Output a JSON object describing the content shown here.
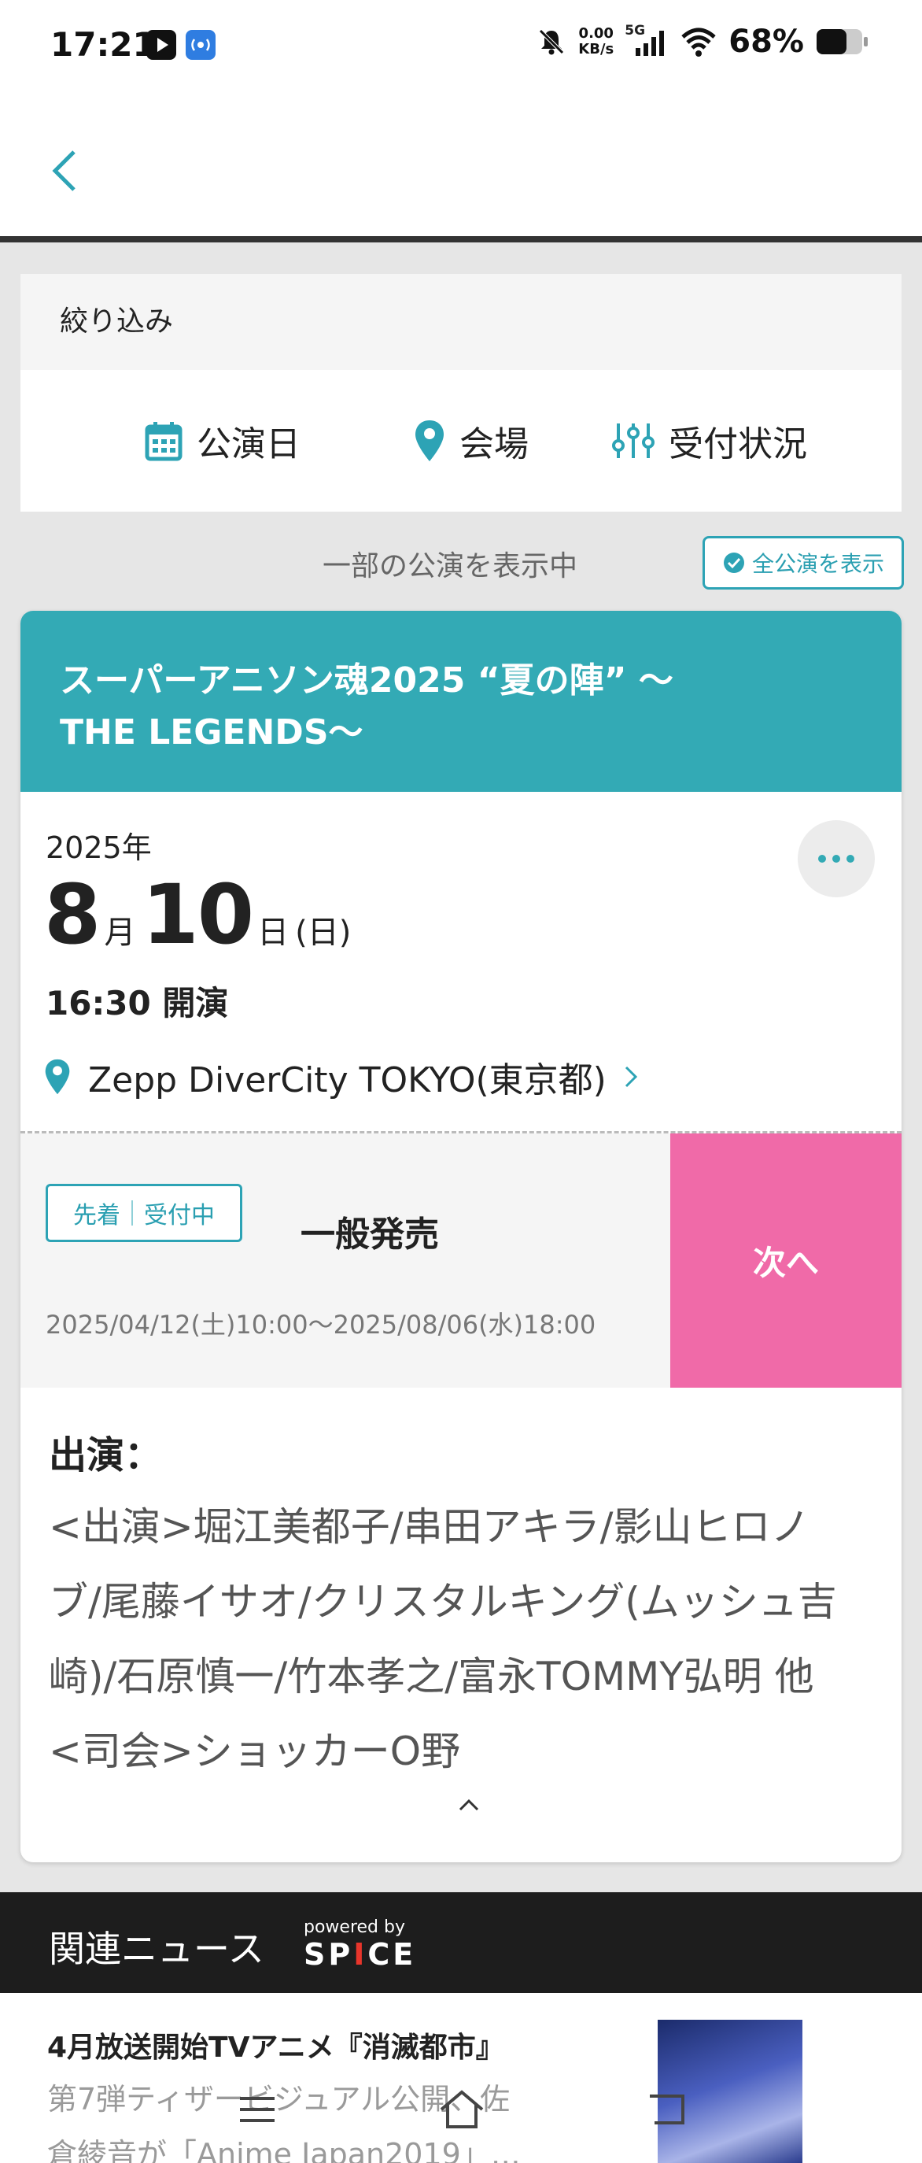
{
  "status_bar": {
    "time": "17:21",
    "net_speed_top": "0.00",
    "net_speed_bottom": "KB/s",
    "network_type": "5G",
    "battery": "68%"
  },
  "filter": {
    "title": "絞り込み",
    "items": [
      {
        "label": "公演日",
        "icon": "calendar-icon"
      },
      {
        "label": "会場",
        "icon": "location-pin-icon"
      },
      {
        "label": "受付状況",
        "icon": "sliders-icon"
      }
    ]
  },
  "display": {
    "partial_text": "一部の公演を表示中",
    "show_all_label": "全公演を表示"
  },
  "event": {
    "title": "スーパーアニソン魂2025 “夏の陣” 〜\nTHE LEGENDS〜",
    "year": "2025年",
    "month": "8",
    "month_unit": "月",
    "day": "10",
    "day_unit": "日",
    "weekday": "(日)",
    "start_time": "16:30 開演",
    "venue": "Zepp DiverCity TOKYO(東京都)",
    "sale": {
      "badge_left": "先着",
      "badge_right": "受付中",
      "title": "一般発売",
      "period": "2025/04/12(土)10:00〜2025/08/06(水)18:00",
      "next_label": "次へ"
    },
    "cast_label": "出演：",
    "cast_text": "<出演>堀江美都子/串田アキラ/影山ヒロノ\nブ/尾藤イサオ/クリスタルキング(ムッシュ吉\n崎)/石原慎一/竹本孝之/富永TOMMY弘明 他\n<司会>ショッカーO野"
  },
  "news": {
    "section_title": "関連ニュース",
    "powered_by": "powered by",
    "brand_pre": "SP",
    "brand_mid": "I",
    "brand_post": "CE",
    "headline": "4月放送開始TVアニメ『消滅都市』",
    "sub": "第7弾ティザービジュアル公開、佐\n倉綾音が「Anime Japan2019」…"
  },
  "colors": {
    "accent": "#33aab5",
    "next_button": "#f06aa8",
    "news_bar": "#1d1d1d"
  }
}
